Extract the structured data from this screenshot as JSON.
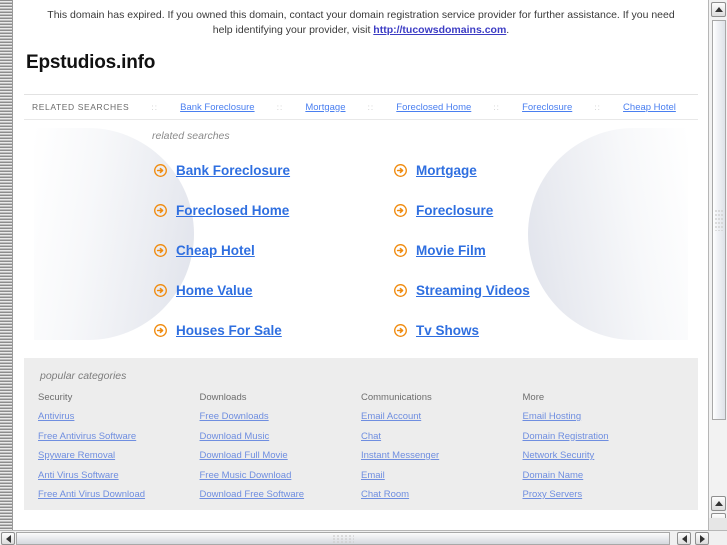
{
  "banner": {
    "text_before": "This domain has expired. If you owned this domain, contact your domain registration service provider for further assistance. If you need help identifying your provider, visit ",
    "link_text": "http://tucowsdomains.com",
    "text_after": "."
  },
  "domain_title": "Epstudios.info",
  "nav": {
    "label": "RELATED SEARCHES",
    "separator": "::",
    "links": [
      "Bank Foreclosure",
      "Mortgage",
      "Foreclosed Home",
      "Foreclosure",
      "Cheap Hotel"
    ]
  },
  "related_searches": {
    "heading": "related searches",
    "left_column": [
      "Bank Foreclosure",
      "Foreclosed Home",
      "Cheap Hotel",
      "Home Value",
      "Houses For Sale"
    ],
    "right_column": [
      "Mortgage",
      "Foreclosure",
      "Movie Film",
      "Streaming Videos",
      "Tv Shows"
    ]
  },
  "popular_categories": {
    "heading": "popular categories",
    "columns": [
      {
        "title": "Security",
        "links": [
          "Antivirus",
          "Free Antivirus Software",
          "Spyware Removal",
          "Anti Virus Software",
          "Free Anti Virus Download"
        ]
      },
      {
        "title": "Downloads",
        "links": [
          "Free Downloads",
          "Download Music",
          "Download Full Movie",
          "Free Music Download",
          "Download Free Software"
        ]
      },
      {
        "title": "Communications",
        "links": [
          "Email Account",
          "Chat",
          "Instant Messenger",
          "Email",
          "Chat Room"
        ]
      },
      {
        "title": "More",
        "links": [
          "Email Hosting",
          "Domain Registration",
          "Network Security",
          "Domain Name",
          "Proxy Servers"
        ]
      }
    ]
  },
  "colors": {
    "link_blue": "#2f6fe0",
    "nav_link_blue": "#4a7ff0",
    "category_link_blue": "#6f8ee0",
    "bullet_orange": "#f08a0c",
    "category_box_bg": "#ededed"
  }
}
